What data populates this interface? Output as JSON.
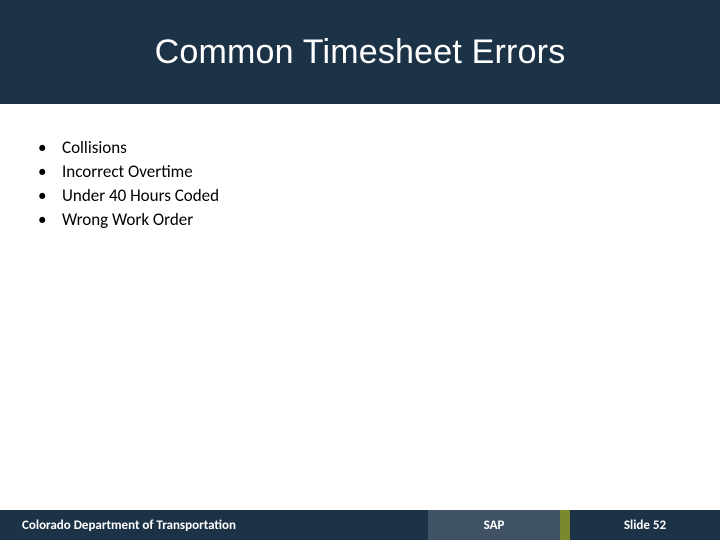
{
  "title": "Common Timesheet Errors",
  "bullets": [
    "Collisions",
    "Incorrect Overtime",
    "Under 40 Hours Coded",
    "Wrong Work Order"
  ],
  "footer": {
    "org": "Colorado Department of Transportation",
    "center": "SAP",
    "slide": "Slide 52"
  }
}
